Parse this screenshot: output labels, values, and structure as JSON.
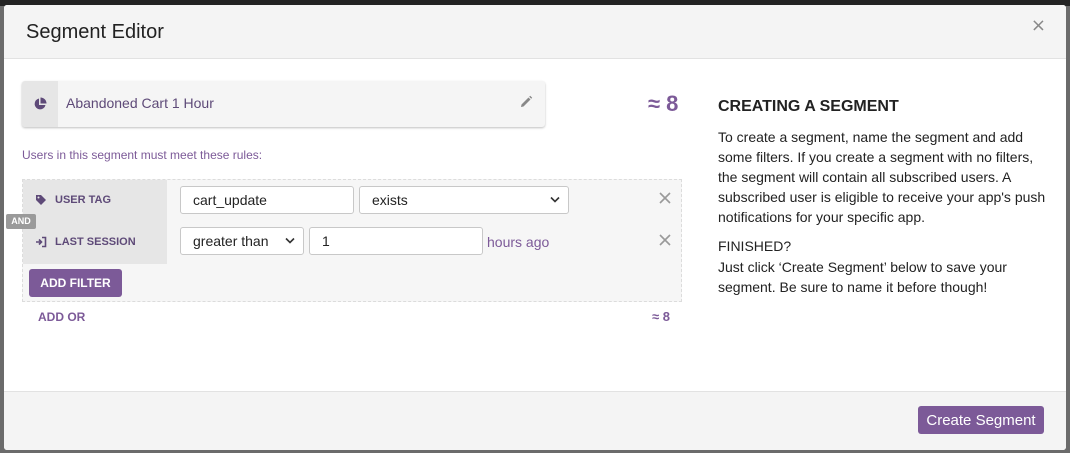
{
  "modal": {
    "title": "Segment Editor",
    "close_label": "×"
  },
  "segment": {
    "name": "Abandoned Cart 1 Hour",
    "estimate": "≈ 8",
    "rules_label": "Users in this segment must meet these rules:",
    "and_badge": "AND",
    "filters": [
      {
        "label": "USER TAG",
        "icon": "tag-icon",
        "value": "cart_update",
        "operator": "exists"
      },
      {
        "label": "LAST SESSION",
        "icon": "sign-in-icon",
        "operator": "greater than",
        "value": "1",
        "unit": "hours ago"
      }
    ],
    "add_filter_label": "ADD FILTER",
    "add_or_label": "ADD OR",
    "group_estimate": "≈ 8"
  },
  "help": {
    "title": "CREATING A SEGMENT",
    "body": "To create a segment, name the segment and add some filters. If you create a segment with no filters, the segment will contain all subscribed users. A subscribed user is eligible to receive your app's push notifications for your specific app.",
    "finished_title": "FINISHED?",
    "finished_body": "Just click ‘Create Segment’ below to save your segment. Be sure to name it before though!"
  },
  "footer": {
    "create_label": "Create Segment"
  },
  "colors": {
    "accent": "#7c5a98",
    "accent_dark": "#5e4a78"
  }
}
